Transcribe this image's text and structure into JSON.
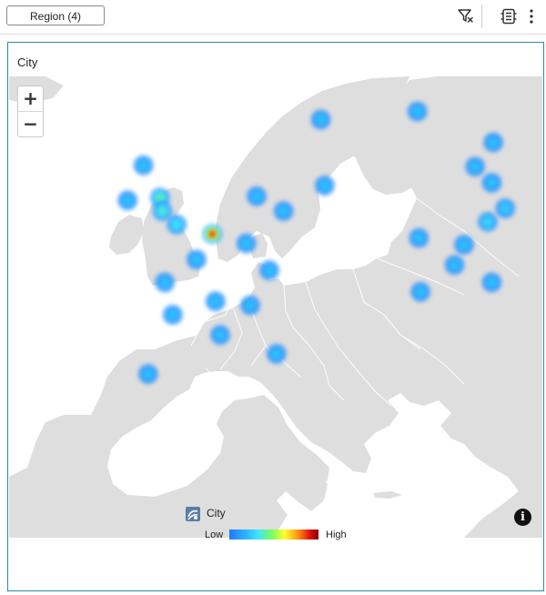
{
  "toolbar": {
    "filter_chip_label": "Region (4)",
    "icons": [
      "filter-clear-icon",
      "layers-icon",
      "more-vertical-icon"
    ]
  },
  "panel": {
    "title": "City",
    "zoom_in_label": "+",
    "zoom_out_label": "−",
    "info_label": "i"
  },
  "map": {
    "type": "heatmap",
    "layer": "City",
    "colors": {
      "land": "#dedede",
      "sea": "#ffffff",
      "border": "#ffffff",
      "low": "#1f78ff",
      "high": "#8a0000"
    },
    "hotspots": [
      {
        "near": "Dublin",
        "lon": -6.3,
        "lat": 53.3,
        "intensity": 0.3
      },
      {
        "near": "Glasgow",
        "lon": -4.3,
        "lat": 55.9,
        "intensity": 0.3
      },
      {
        "near": "Manchester",
        "lon": -2.2,
        "lat": 53.5,
        "intensity": 0.55
      },
      {
        "near": "Birmingham",
        "lon": -1.9,
        "lat": 52.5,
        "intensity": 0.5
      },
      {
        "near": "London",
        "lon": -0.1,
        "lat": 51.5,
        "intensity": 0.45
      },
      {
        "near": "Brussels",
        "lon": 4.4,
        "lat": 50.8,
        "intensity": 0.95
      },
      {
        "near": "Paris",
        "lon": 2.4,
        "lat": 48.9,
        "intensity": 0.3
      },
      {
        "near": "Nantes",
        "lon": -1.6,
        "lat": 47.2,
        "intensity": 0.3
      },
      {
        "near": "Bordeaux",
        "lon": -0.6,
        "lat": 44.8,
        "intensity": 0.3
      },
      {
        "near": "Lyon",
        "lon": 4.8,
        "lat": 45.8,
        "intensity": 0.3
      },
      {
        "near": "Marseille",
        "lon": 5.4,
        "lat": 43.3,
        "intensity": 0.3
      },
      {
        "near": "Madrid",
        "lon": -3.7,
        "lat": 40.4,
        "intensity": 0.3
      },
      {
        "near": "Hamburg",
        "lon": 10.0,
        "lat": 53.6,
        "intensity": 0.3
      },
      {
        "near": "Berlin",
        "lon": 13.4,
        "lat": 52.5,
        "intensity": 0.3
      },
      {
        "near": "Frankfurt",
        "lon": 8.7,
        "lat": 50.1,
        "intensity": 0.3
      },
      {
        "near": "Munich",
        "lon": 11.6,
        "lat": 48.1,
        "intensity": 0.3
      },
      {
        "near": "Milan",
        "lon": 9.2,
        "lat": 45.5,
        "intensity": 0.3
      },
      {
        "near": "Rome",
        "lon": 12.5,
        "lat": 41.9,
        "intensity": 0.3
      },
      {
        "near": "Stockholm",
        "lon": 18.1,
        "lat": 59.3,
        "intensity": 0.3
      },
      {
        "near": "Gdansk",
        "lon": 18.6,
        "lat": 54.4,
        "intensity": 0.3
      },
      {
        "near": "St Petersburg",
        "lon": 30.3,
        "lat": 59.9,
        "intensity": 0.3
      },
      {
        "near": "Yaroslavl",
        "lon": 39.9,
        "lat": 57.6,
        "intensity": 0.3
      },
      {
        "near": "Moscow",
        "lon": 37.6,
        "lat": 55.8,
        "intensity": 0.3
      },
      {
        "near": "Ryazan",
        "lon": 39.7,
        "lat": 54.6,
        "intensity": 0.3
      },
      {
        "near": "Tambov",
        "lon": 41.4,
        "lat": 52.7,
        "intensity": 0.35
      },
      {
        "near": "Voronezh",
        "lon": 39.2,
        "lat": 51.7,
        "intensity": 0.4
      },
      {
        "near": "Kyiv",
        "lon": 30.5,
        "lat": 50.5,
        "intensity": 0.3
      },
      {
        "near": "Kharkiv",
        "lon": 36.2,
        "lat": 50.0,
        "intensity": 0.3
      },
      {
        "near": "Dnipro",
        "lon": 35.0,
        "lat": 48.5,
        "intensity": 0.3
      },
      {
        "near": "Rostov",
        "lon": 39.7,
        "lat": 47.2,
        "intensity": 0.3
      },
      {
        "near": "Odesa",
        "lon": 30.7,
        "lat": 46.5,
        "intensity": 0.3
      }
    ]
  },
  "legend": {
    "layer_name": "City",
    "low_label": "Low",
    "high_label": "High"
  }
}
